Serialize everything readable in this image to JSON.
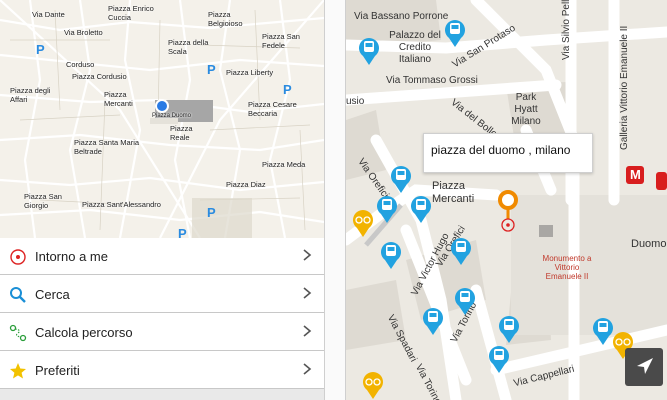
{
  "left_map": {
    "streets": [
      "Via Dante",
      "Via Broletto",
      "Piazza Cordusio",
      "Corduso",
      "Piazza degli Affari",
      "Piazza Mercanti",
      "Piazza Santa Maria Beltrade",
      "Piazza San Giorgio",
      "Piazza Sant'Alessandro",
      "Piazza Reale",
      "Piazza della Scala",
      "Piazza Cesare Beccaria",
      "Piazza Liberty",
      "Piazza Belgioioso",
      "Piazza Enrico Cuccia",
      "Piazza San Fedele",
      "Piazza Meda",
      "Piazza Diaz",
      "Piazza Duomo"
    ],
    "parking_letter": "P"
  },
  "menu": {
    "items": [
      {
        "label": "Intorno a me",
        "icon": "target-icon"
      },
      {
        "label": "Cerca",
        "icon": "magnifier-icon"
      },
      {
        "label": "Calcola percorso",
        "icon": "route-icon"
      },
      {
        "label": "Preferiti",
        "icon": "star-icon"
      }
    ]
  },
  "right_map": {
    "search_text": "piazza del duomo , milano",
    "labels": {
      "via_bassano_porrone": "Via Bassano Porrone",
      "palazzo_credito": "Palazzo del Credito Italiano",
      "via_san_protaso": "Via San Protaso",
      "via_tommaso_grossi": "Via Tommaso Grossi",
      "park_hyatt": "Park Hyatt Milano",
      "via_silvio_pellico": "Via Silvio Pellico",
      "galleria": "Galleria Vittorio Emanuele II",
      "via_del_bollo": "Via del Bollo",
      "usio": "usio",
      "via_orefici_1": "Via Orefici",
      "via_orefici_2": "Via Orefici",
      "piazza_mercanti": "Piazza Mercanti",
      "via_victor_hugo": "Via Victor Hugo",
      "monumento": "Monumento a Vittorio Emanuele II",
      "duomo": "Duomo",
      "via_spadari": "Via Spadari",
      "via_torino_1": "Via Torino",
      "via_torino_2": "Via Torino",
      "via_cappellari": "Via Cappellari"
    },
    "metro_letter": "M"
  },
  "colors": {
    "bus": "#22a2e0",
    "bike": "#f2b300",
    "pin": "#f08a00",
    "metro": "#d81e1e",
    "location_dot": "#2a7be4"
  }
}
